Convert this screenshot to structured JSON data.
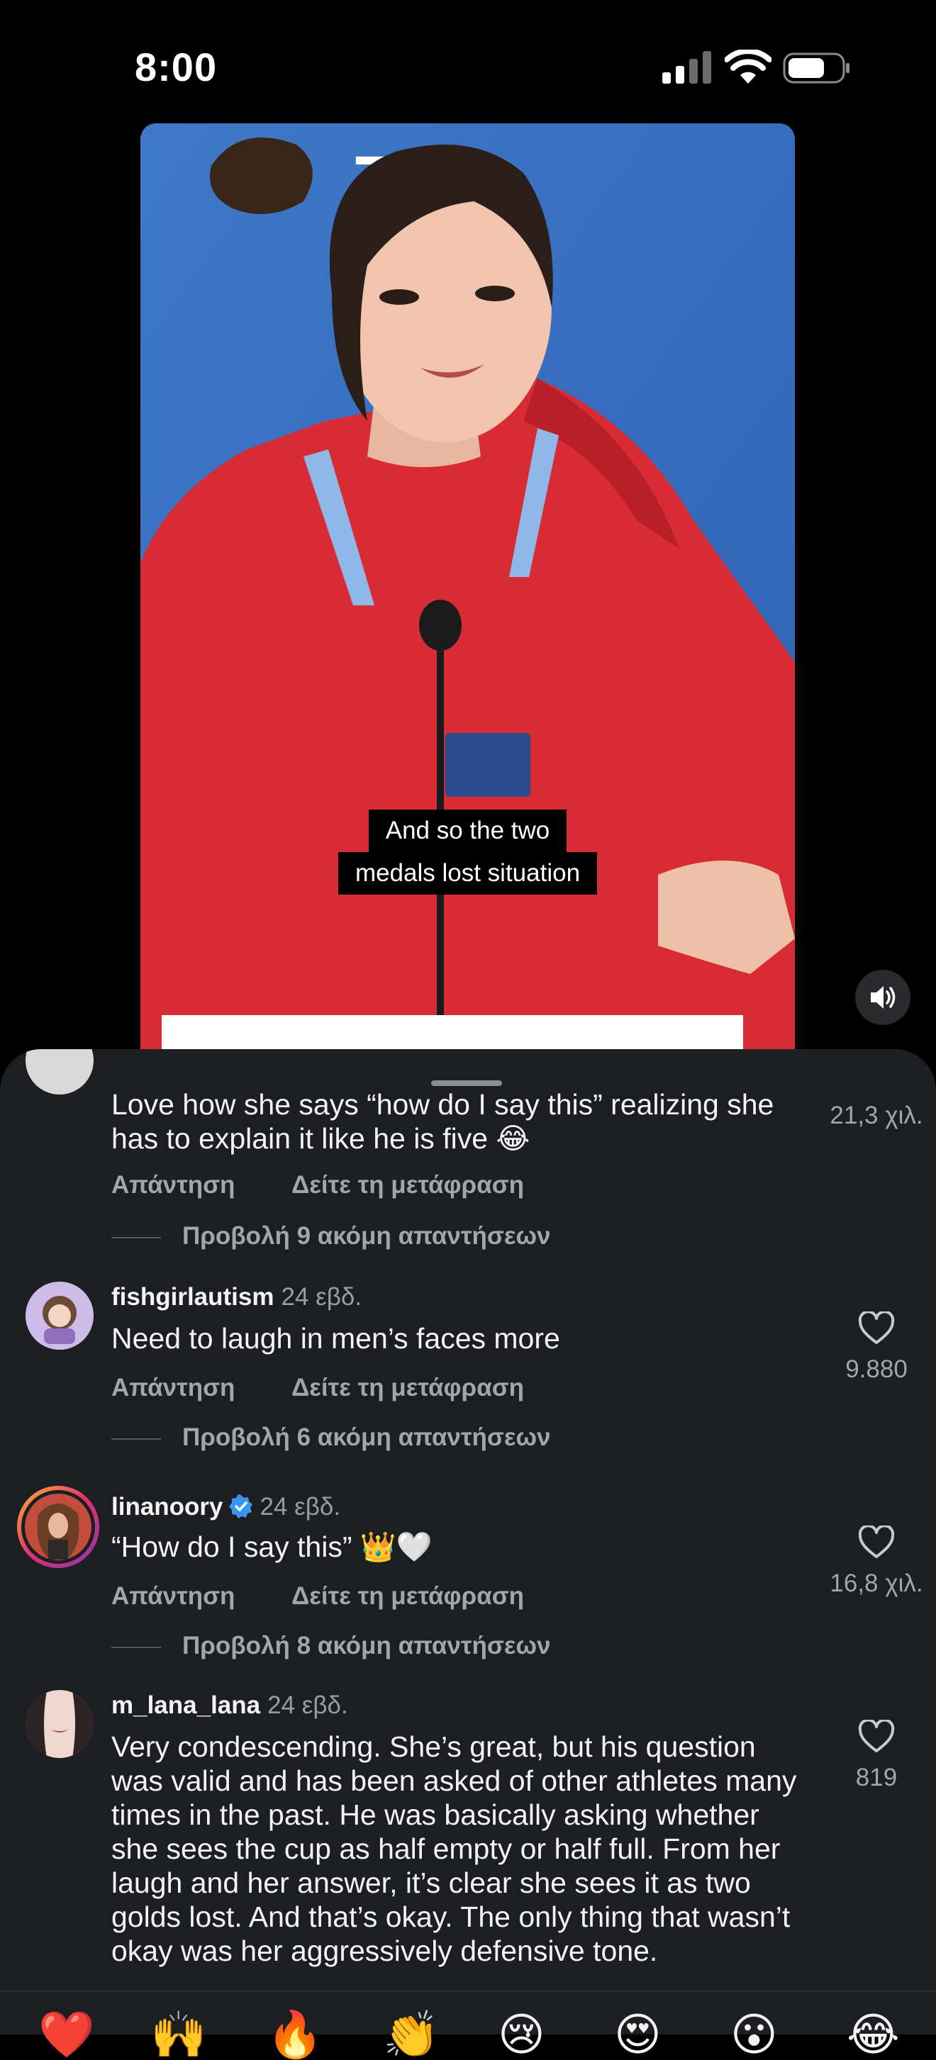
{
  "status_bar": {
    "time": "8:00"
  },
  "video": {
    "sign_text": "TCL",
    "caption_lines": [
      "And so the two",
      "medals lost situation"
    ],
    "sound_icon": "speaker-icon"
  },
  "comments": [
    {
      "text": "Love how she says “how do I say this” realizing she has to explain it like he is five 😂",
      "like_count": "21,3 χιλ.",
      "reply_label": "Απάντηση",
      "translate_label": "Δείτε τη μετάφραση",
      "more_replies": "Προβολή 9 ακόμη απαντήσεων"
    },
    {
      "username": "fishgirlautism",
      "time": "24 εβδ.",
      "text": "Need to laugh in men’s faces more",
      "like_count": "9.880",
      "reply_label": "Απάντηση",
      "translate_label": "Δείτε τη μετάφραση",
      "more_replies": "Προβολή 6 ακόμη απαντήσεων"
    },
    {
      "username": "linanoory",
      "verified": true,
      "time": "24 εβδ.",
      "text": "“How do I say this” 👑🤍",
      "like_count": "16,8 χιλ.",
      "reply_label": "Απάντηση",
      "translate_label": "Δείτε τη μετάφραση",
      "more_replies": "Προβολή 8 ακόμη απαντήσεων"
    },
    {
      "username": "m_lana_lana",
      "time": "24 εβδ.",
      "text": "Very condescending. She’s great, but his question was valid and has been asked of other athletes many times in the past. He was basically asking whether she sees the cup as half empty or half full. From her laugh and her answer, it’s clear she sees it as two golds lost. And that’s okay. The only thing that wasn’t okay was her aggressively defensive tone.",
      "like_count": "819"
    }
  ],
  "emoji_bar": [
    "❤️",
    "🙌",
    "🔥",
    "👏",
    "😢",
    "😍",
    "😮",
    "😂"
  ],
  "colors": {
    "sheet_bg": "#1c1e22",
    "muted_text": "#a3a5aa",
    "verified_blue": "#3797f0",
    "story_ring": "#e1306c"
  }
}
